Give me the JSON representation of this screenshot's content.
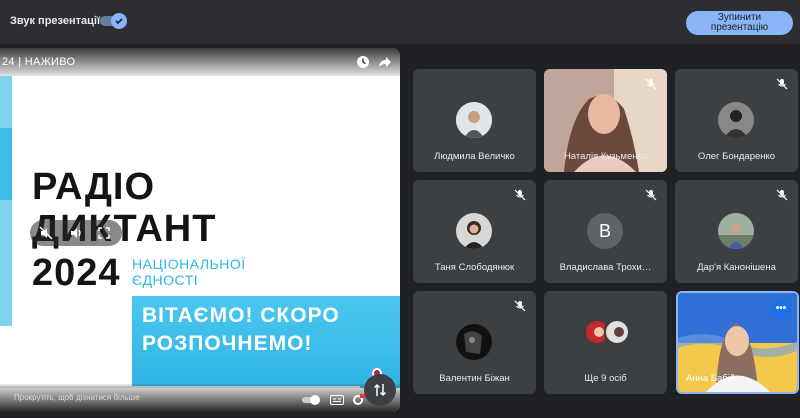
{
  "topbar": {
    "sound_label": "Звук презентації",
    "stop_button_line1": "Зупинити",
    "stop_button_line2": "презентацію"
  },
  "presentation": {
    "live_label": "24 | НАЖИВО",
    "title_line1": "РАДІО",
    "title_line2": "ДИКТАНТ",
    "title_line3": "2024",
    "subtitle_line1": "НАЦІОНАЛЬНОЇ",
    "subtitle_line2": "ЄДНОСТІ",
    "greeting_line1": "ВІТАЄМО! СКОРО",
    "greeting_line2": "РОЗПОЧНЕМО!",
    "scroll_hint": "Прокрутіть, щоб дізнатися більше"
  },
  "participants": [
    {
      "name": "Людмила Величко",
      "muted": false
    },
    {
      "name": "Наталія Кузьменко",
      "muted": true
    },
    {
      "name": "Олег Бондаренко",
      "muted": true
    },
    {
      "name": "Таня Слободянюк",
      "muted": true
    },
    {
      "name": "Владислава Трохи…",
      "initial": "В",
      "muted": true
    },
    {
      "name": "Дар'я Канонішена",
      "muted": true
    },
    {
      "name": "Валентин Біжан",
      "muted": true
    },
    {
      "name": "Ще 9 осіб",
      "muted": false
    },
    {
      "name": "Анна Бабій",
      "muted": false
    }
  ],
  "colors": {
    "accent": "#8ab4f8",
    "tile_bg": "#3c4043",
    "page_bg": "#202124",
    "slide_blue": "#2fb6e4"
  }
}
